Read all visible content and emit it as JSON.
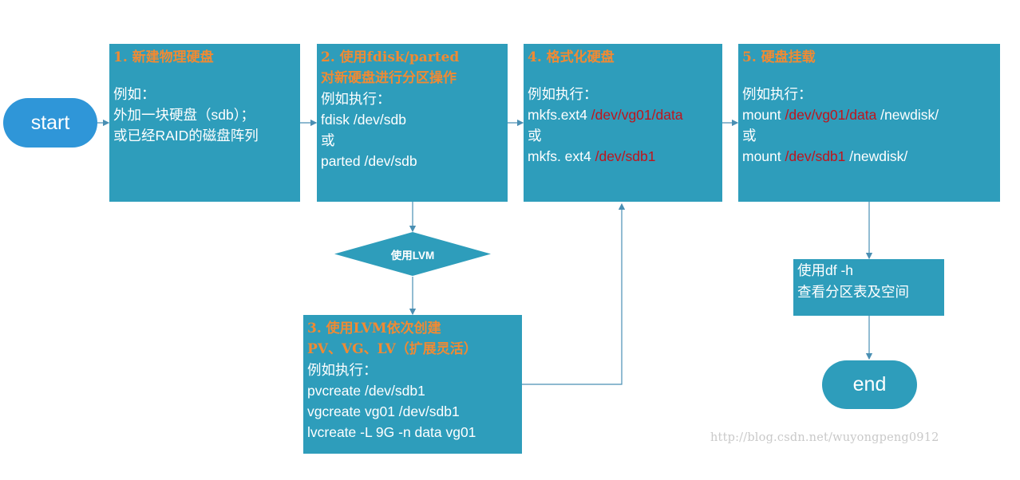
{
  "start_node": {
    "label": "start"
  },
  "end_node": {
    "label": "end"
  },
  "step1": {
    "title": "1. 新建物理硬盘",
    "lines": [
      "例如：",
      "外加一块硬盘（sdb）；",
      "或已经RAID的磁盘阵列"
    ]
  },
  "step2": {
    "title_line1": "2. 使用fdisk/parted",
    "title_line2": "对新硬盘进行分区操作",
    "lines": [
      "例如执行：",
      "fdisk  /dev/sdb",
      "或",
      "parted  /dev/sdb"
    ]
  },
  "decision": {
    "label": "使用LVM"
  },
  "step3": {
    "title_line1": "3. 使用LVM依次创建",
    "title_line2": "PV、VG、LV（扩展灵活）",
    "lines": [
      "例如执行：",
      "pvcreate /dev/sdb1",
      "vgcreate vg01 /dev/sdb1",
      "lvcreate -L 9G -n data vg01"
    ]
  },
  "step4": {
    "title": "4. 格式化硬盘",
    "line_intro": "例如执行：",
    "cmd1_prefix": "mkfs.ext4 ",
    "cmd1_target": "/dev/vg01/data",
    "or_label": "或",
    "cmd2_prefix": "mkfs. ext4 ",
    "cmd2_target": "/dev/sdb1"
  },
  "step5": {
    "title": "5. 硬盘挂载",
    "line_intro": "例如执行：",
    "cmd1_prefix": "mount ",
    "cmd1_target": "/dev/vg01/data",
    "cmd1_suffix": " /newdisk/",
    "or_label": "或",
    "cmd2_prefix": "mount ",
    "cmd2_target": "/dev/sdb1",
    "cmd2_suffix": "  /newdisk/"
  },
  "check": {
    "line1": "使用df  -h",
    "line2": "查看分区表及空间"
  },
  "watermark": "http://blog.csdn.net/wuyongpeng0912",
  "colors": {
    "box": "#2e9dbb",
    "start": "#2f96d8",
    "title": "#f08a33",
    "highlight": "#c0141c",
    "connector": "#4a8fb3"
  }
}
